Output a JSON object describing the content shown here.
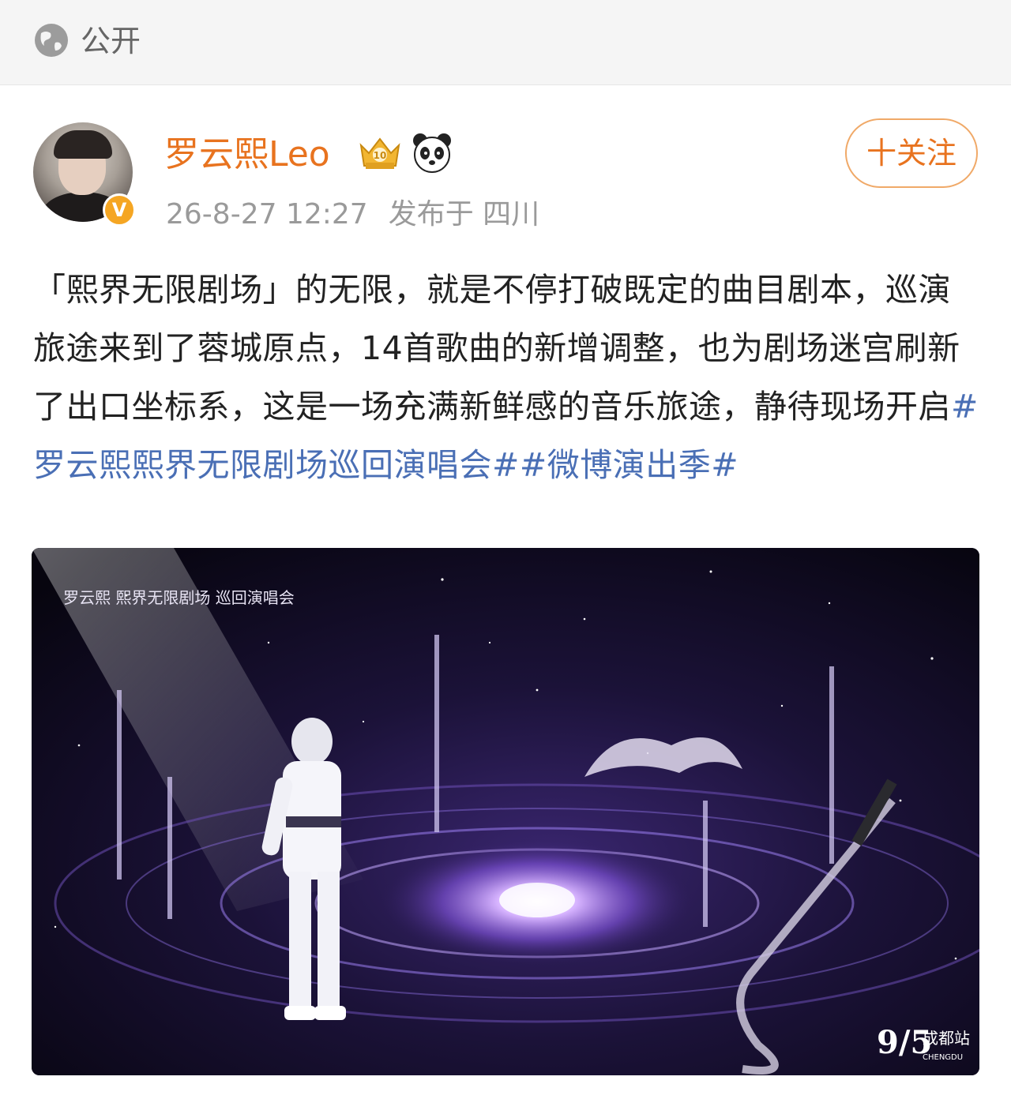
{
  "header": {
    "visibility_label": "公开",
    "visibility_icon": "globe-icon"
  },
  "author": {
    "name": "罗云熙Leo",
    "verified_mark": "V",
    "badges": [
      "crown-level-icon",
      "panda-icon"
    ],
    "date": "26-8-27 12:27",
    "location": "发布于 四川"
  },
  "follow_button": {
    "label": "十关注"
  },
  "post": {
    "text": "「熙界无限剧场」的无限，就是不停打破既定的曲目剧本，巡演旅途来到了蓉城原点，14首歌曲的新增调整，也为剧场迷宫刷新了出口坐标系，这是一场充满新鲜感的音乐旅途，静待现场开启",
    "hashtags": [
      "#罗云熙熙界无限剧场巡回演唱会#",
      "#微博演出季#"
    ]
  },
  "image": {
    "caption_top": "罗云熙  熙界无限剧场  巡回演唱会",
    "date_text": "9/5",
    "city_text": "成都站",
    "city_en": "CHENGDU",
    "colors": {
      "background": "#0e0a1c",
      "galaxy": "#7a4fd0",
      "accent": "#c9b6ff"
    }
  },
  "colors": {
    "accent_orange": "#e8731f",
    "link_blue": "#4a6fb5",
    "meta_gray": "#9a9a9a"
  }
}
